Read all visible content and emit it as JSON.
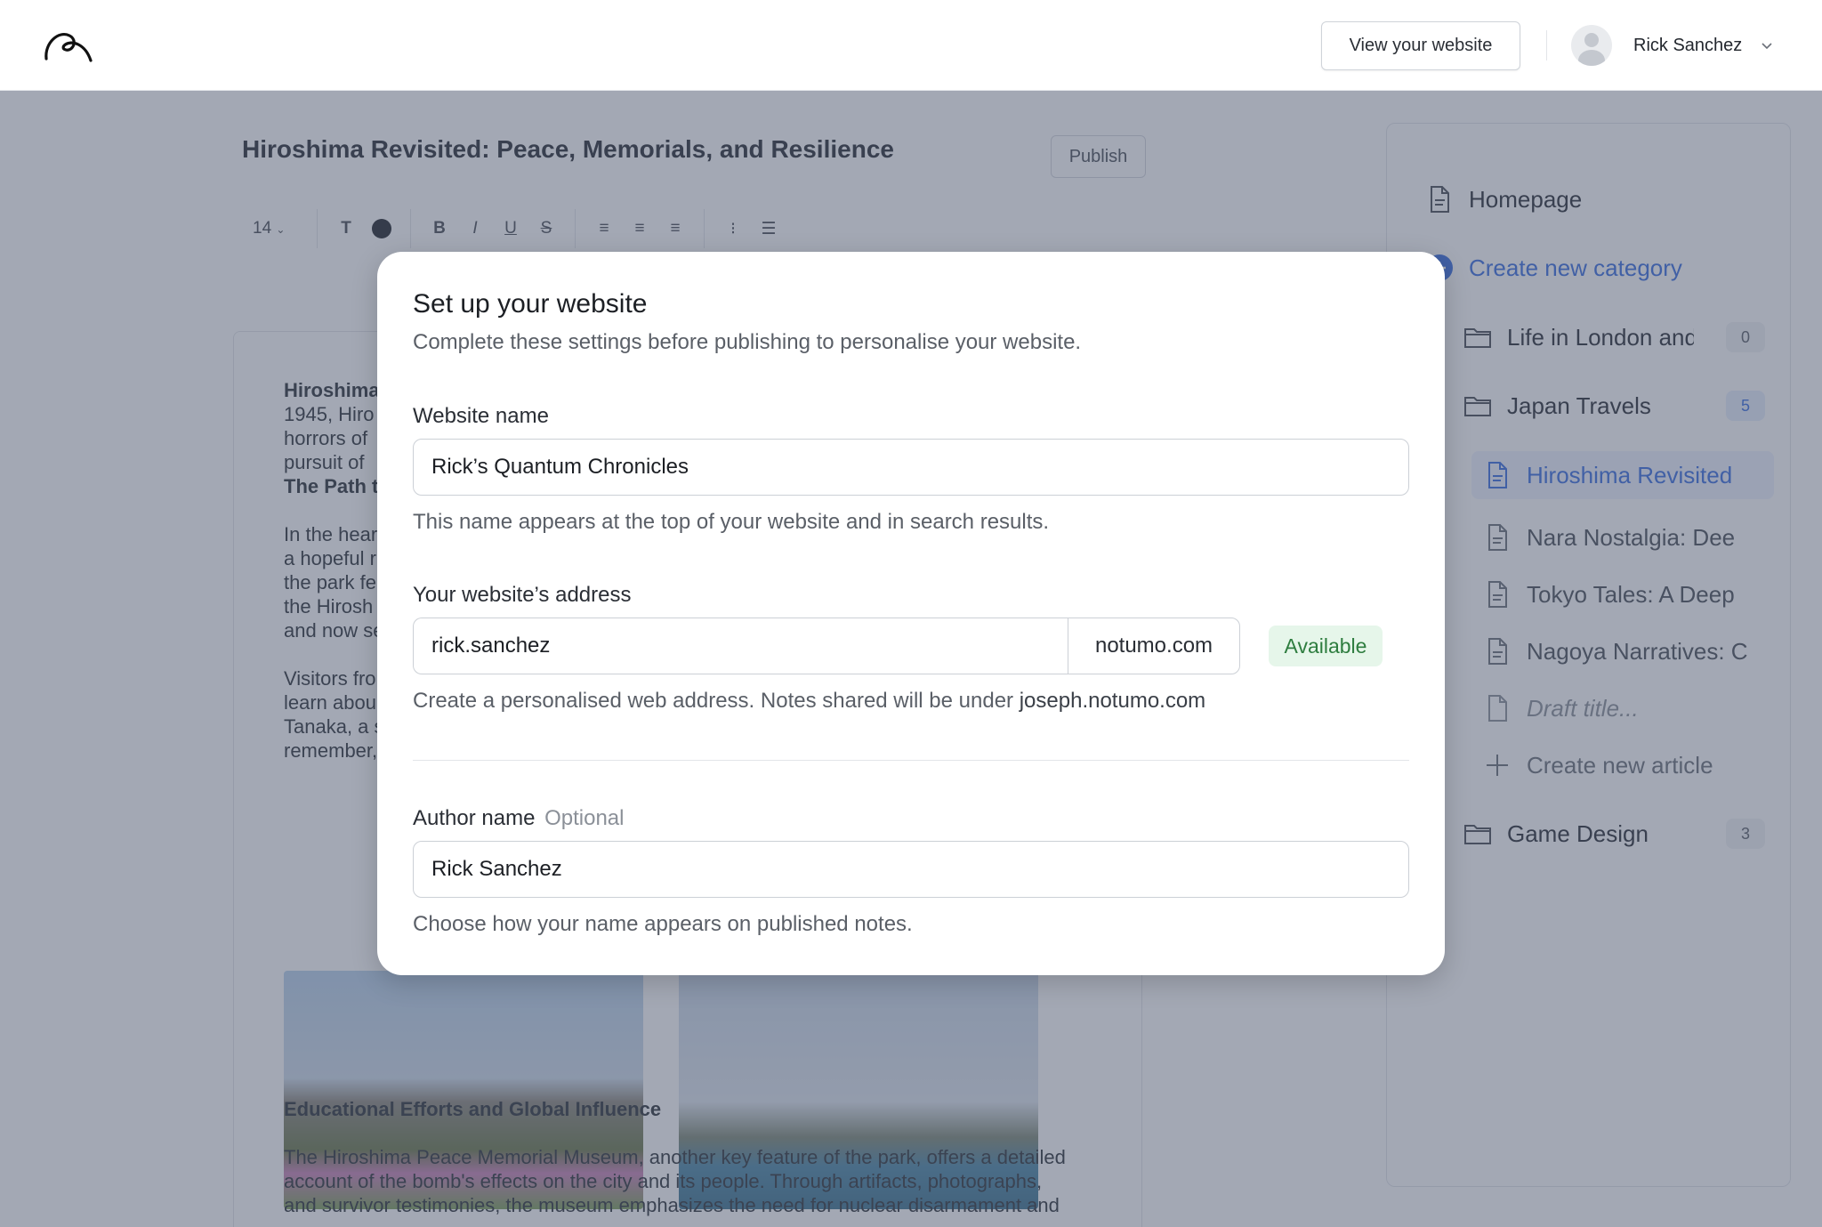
{
  "topbar": {
    "view_site_label": "View your website",
    "user_name": "Rick Sanchez"
  },
  "editor": {
    "doc_title": "Hiroshima Revisited: Peace, Memorials, and Resilience",
    "publish_label": "Publish",
    "font_size": "14",
    "text_tool": "T",
    "lines": [
      "Hiroshima",
      "1945, Hiro",
      "horrors of",
      "pursuit of"
    ],
    "heading_path": "The Path t",
    "para2": [
      "In the hear",
      "a hopeful r",
      "the park fe",
      "the Hirosh",
      "and now se"
    ],
    "para3": [
      "Visitors fro",
      "learn abou",
      "Tanaka, a s",
      "remember,"
    ],
    "heading_edu": "Educational Efforts and Global Influence",
    "para4": [
      "The Hiroshima Peace Memorial Museum, another key feature of the park, offers a detailed",
      "account of the bomb's effects on the city and its people. Through artifacts, photographs,",
      "and survivor testimonies, the museum emphasizes the need for nuclear disarmament and"
    ]
  },
  "sidebar": {
    "homepage": "Homepage",
    "create_category": "Create new category",
    "folders": [
      {
        "label": "Life in London and",
        "count": "0"
      },
      {
        "label": "Japan Travels",
        "count": "5"
      },
      {
        "label": "Game Design",
        "count": "3"
      }
    ],
    "articles": [
      "Hiroshima Revisited",
      "Nara Nostalgia: Dee",
      "Tokyo Tales: A Deep",
      "Nagoya Narratives: C",
      "Draft title...",
      "Create new article"
    ]
  },
  "modal": {
    "title": "Set up your website",
    "subtitle": "Complete these settings before publishing to personalise your website.",
    "website_name": {
      "label": "Website name",
      "value": "Rick’s Quantum Chronicles",
      "help": "This name appears at the top of your website and in search results."
    },
    "address": {
      "label": "Your website’s address",
      "value": "rick.sanchez",
      "domain": "notumo.com",
      "status": "Available",
      "help_prefix": "Create a personalised web address. Notes shared will be under ",
      "help_example": "joseph.notumo.com"
    },
    "author": {
      "label": "Author name",
      "optional": "Optional",
      "value": "Rick Sanchez",
      "help": "Choose how your name appears on published notes."
    }
  },
  "colors": {
    "overlay": "#48526a",
    "accent": "#3b6fe0",
    "available_bg": "#e6f6ea",
    "available_text": "#2e7d3f"
  }
}
